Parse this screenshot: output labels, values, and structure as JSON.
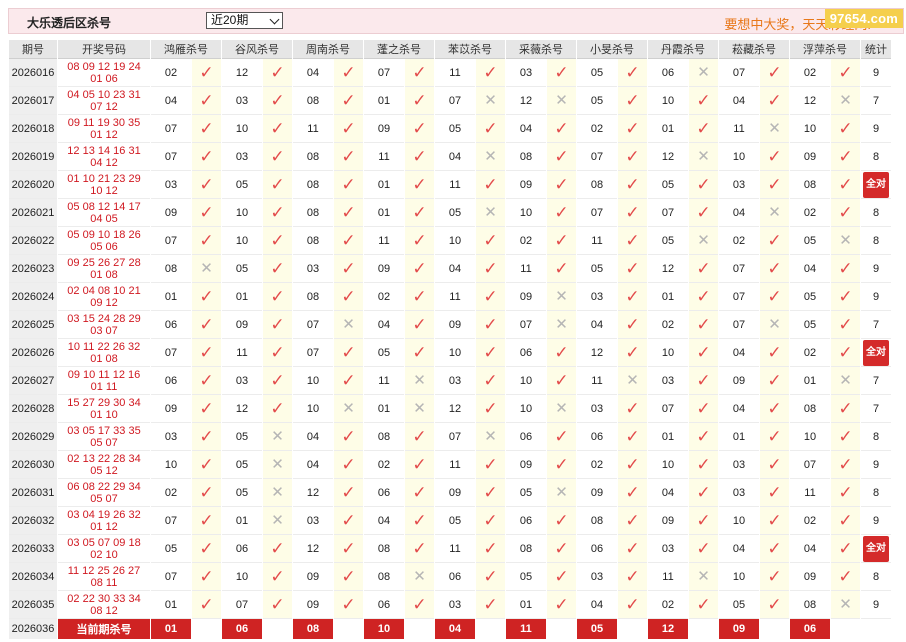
{
  "header": {
    "title": "大乐透后区杀号",
    "period_option": "近20期",
    "slogan": "要想中大奖，天天彩经网!",
    "watermark": "97654.com"
  },
  "columns": {
    "issue": "期号",
    "draw": "开奖号码",
    "experts": [
      "鸿雁杀号",
      "谷风杀号",
      "周南杀号",
      "蓬之杀号",
      "苯苡杀号",
      "采薇杀号",
      "小旻杀号",
      "丹霞杀号",
      "菘藏杀号",
      "浮萍杀号"
    ],
    "stat": "统计"
  },
  "all_correct_label": "全对",
  "rows": [
    {
      "issue": "2026016",
      "front": "08 09 12 19 24",
      "back": "01 06",
      "picks": [
        "02",
        "12",
        "04",
        "07",
        "11",
        "03",
        "05",
        "06",
        "07",
        "02"
      ],
      "results": [
        1,
        1,
        1,
        1,
        1,
        1,
        1,
        0,
        1,
        1
      ],
      "stat": "9"
    },
    {
      "issue": "2026017",
      "front": "04 05 10 23 31",
      "back": "07 12",
      "picks": [
        "04",
        "03",
        "08",
        "01",
        "07",
        "12",
        "05",
        "10",
        "04",
        "12"
      ],
      "results": [
        1,
        1,
        1,
        1,
        0,
        0,
        1,
        1,
        1,
        0
      ],
      "stat": "7"
    },
    {
      "issue": "2026018",
      "front": "09 11 19 30 35",
      "back": "01 12",
      "picks": [
        "07",
        "10",
        "11",
        "09",
        "05",
        "04",
        "02",
        "01",
        "11",
        "10"
      ],
      "results": [
        1,
        1,
        1,
        1,
        1,
        1,
        1,
        1,
        0,
        1
      ],
      "stat": "9"
    },
    {
      "issue": "2026019",
      "front": "12 13 14 16 31",
      "back": "04 12",
      "picks": [
        "07",
        "03",
        "08",
        "11",
        "04",
        "08",
        "07",
        "12",
        "10",
        "09"
      ],
      "results": [
        1,
        1,
        1,
        1,
        0,
        1,
        1,
        0,
        1,
        1
      ],
      "stat": "8"
    },
    {
      "issue": "2026020",
      "front": "01 10 21 23 29",
      "back": "10 12",
      "picks": [
        "03",
        "05",
        "08",
        "01",
        "11",
        "09",
        "08",
        "05",
        "03",
        "08"
      ],
      "results": [
        1,
        1,
        1,
        1,
        1,
        1,
        1,
        1,
        1,
        1
      ],
      "stat": "全对"
    },
    {
      "issue": "2026021",
      "front": "05 08 12 14 17",
      "back": "04 05",
      "picks": [
        "09",
        "10",
        "08",
        "01",
        "05",
        "10",
        "07",
        "07",
        "04",
        "02"
      ],
      "results": [
        1,
        1,
        1,
        1,
        0,
        1,
        1,
        1,
        0,
        1
      ],
      "stat": "8"
    },
    {
      "issue": "2026022",
      "front": "05 09 10 18 26",
      "back": "05 06",
      "picks": [
        "07",
        "10",
        "08",
        "11",
        "10",
        "02",
        "11",
        "05",
        "02",
        "05"
      ],
      "results": [
        1,
        1,
        1,
        1,
        1,
        1,
        1,
        0,
        1,
        0
      ],
      "stat": "8"
    },
    {
      "issue": "2026023",
      "front": "09 25 26 27 28",
      "back": "01 08",
      "picks": [
        "08",
        "05",
        "03",
        "09",
        "04",
        "11",
        "05",
        "12",
        "07",
        "04"
      ],
      "results": [
        0,
        1,
        1,
        1,
        1,
        1,
        1,
        1,
        1,
        1
      ],
      "stat": "9"
    },
    {
      "issue": "2026024",
      "front": "02 04 08 10 21",
      "back": "09 12",
      "picks": [
        "01",
        "01",
        "08",
        "02",
        "11",
        "09",
        "03",
        "01",
        "07",
        "05"
      ],
      "results": [
        1,
        1,
        1,
        1,
        1,
        0,
        1,
        1,
        1,
        1
      ],
      "stat": "9"
    },
    {
      "issue": "2026025",
      "front": "03 15 24 28 29",
      "back": "03 07",
      "picks": [
        "06",
        "09",
        "07",
        "04",
        "09",
        "07",
        "04",
        "02",
        "07",
        "05"
      ],
      "results": [
        1,
        1,
        0,
        1,
        1,
        0,
        1,
        1,
        0,
        1
      ],
      "stat": "7"
    },
    {
      "issue": "2026026",
      "front": "10 11 22 26 32",
      "back": "01 08",
      "picks": [
        "07",
        "11",
        "07",
        "05",
        "10",
        "06",
        "12",
        "10",
        "04",
        "02"
      ],
      "results": [
        1,
        1,
        1,
        1,
        1,
        1,
        1,
        1,
        1,
        1
      ],
      "stat": "全对"
    },
    {
      "issue": "2026027",
      "front": "09 10 11 12 16",
      "back": "01 11",
      "picks": [
        "06",
        "03",
        "10",
        "11",
        "03",
        "10",
        "11",
        "03",
        "09",
        "01"
      ],
      "results": [
        1,
        1,
        1,
        0,
        1,
        1,
        0,
        1,
        1,
        0
      ],
      "stat": "7"
    },
    {
      "issue": "2026028",
      "front": "15 27 29 30 34",
      "back": "01 10",
      "picks": [
        "09",
        "12",
        "10",
        "01",
        "12",
        "10",
        "03",
        "07",
        "04",
        "08"
      ],
      "results": [
        1,
        1,
        0,
        0,
        1,
        0,
        1,
        1,
        1,
        1
      ],
      "stat": "7"
    },
    {
      "issue": "2026029",
      "front": "03 05 17 33 35",
      "back": "05 07",
      "picks": [
        "03",
        "05",
        "04",
        "08",
        "07",
        "06",
        "06",
        "01",
        "01",
        "10"
      ],
      "results": [
        1,
        0,
        1,
        1,
        0,
        1,
        1,
        1,
        1,
        1
      ],
      "stat": "8"
    },
    {
      "issue": "2026030",
      "front": "02 13 22 28 34",
      "back": "05 12",
      "picks": [
        "10",
        "05",
        "04",
        "02",
        "11",
        "09",
        "02",
        "10",
        "03",
        "07"
      ],
      "results": [
        1,
        0,
        1,
        1,
        1,
        1,
        1,
        1,
        1,
        1
      ],
      "stat": "9"
    },
    {
      "issue": "2026031",
      "front": "06 08 22 29 34",
      "back": "05 07",
      "picks": [
        "02",
        "05",
        "12",
        "06",
        "09",
        "05",
        "09",
        "04",
        "03",
        "11"
      ],
      "results": [
        1,
        0,
        1,
        1,
        1,
        0,
        1,
        1,
        1,
        1
      ],
      "stat": "8"
    },
    {
      "issue": "2026032",
      "front": "03 04 19 26 32",
      "back": "01 12",
      "picks": [
        "07",
        "01",
        "03",
        "04",
        "05",
        "06",
        "08",
        "09",
        "10",
        "02"
      ],
      "results": [
        1,
        0,
        1,
        1,
        1,
        1,
        1,
        1,
        1,
        1
      ],
      "stat": "9"
    },
    {
      "issue": "2026033",
      "front": "03 05 07 09 18",
      "back": "02 10",
      "picks": [
        "05",
        "06",
        "12",
        "08",
        "11",
        "08",
        "06",
        "03",
        "04",
        "04"
      ],
      "results": [
        1,
        1,
        1,
        1,
        1,
        1,
        1,
        1,
        1,
        1
      ],
      "stat": "全对"
    },
    {
      "issue": "2026034",
      "front": "11 12 25 26 27",
      "back": "08 11",
      "picks": [
        "07",
        "10",
        "09",
        "08",
        "06",
        "05",
        "03",
        "11",
        "10",
        "09"
      ],
      "results": [
        1,
        1,
        1,
        0,
        1,
        1,
        1,
        0,
        1,
        1
      ],
      "stat": "8"
    },
    {
      "issue": "2026035",
      "front": "02 22 30 33 34",
      "back": "08 12",
      "picks": [
        "01",
        "07",
        "09",
        "06",
        "03",
        "01",
        "04",
        "02",
        "05",
        "08"
      ],
      "results": [
        1,
        1,
        1,
        1,
        1,
        1,
        1,
        1,
        1,
        0
      ],
      "stat": "9"
    }
  ],
  "current": {
    "issue": "2026036",
    "label": "当前期杀号",
    "picks": [
      "01",
      "06",
      "08",
      "10",
      "04",
      "11",
      "05",
      "12",
      "09",
      "06"
    ]
  },
  "colors": {
    "accent": "#cf2323",
    "check": "#e34b4b",
    "cross": "#b5b5b5",
    "mark_bg": "#fefde7"
  }
}
